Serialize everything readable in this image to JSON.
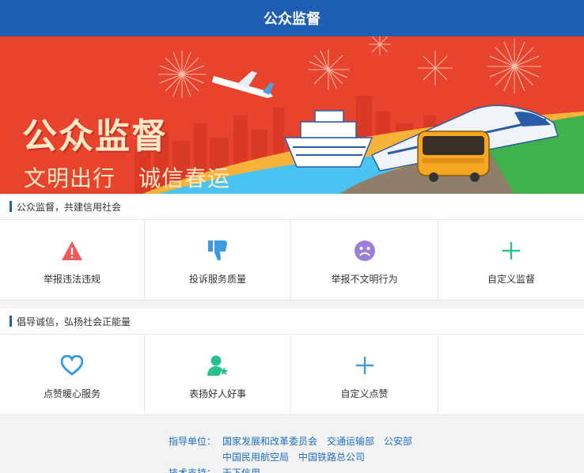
{
  "header": {
    "title": "公众监督"
  },
  "banner": {
    "title": "公众监督",
    "subtitle": "文明出行　诚信春运"
  },
  "section1": {
    "title": "公众监督，共建信用社会",
    "items": [
      {
        "label": "举报违法违规",
        "icon": "warning-icon",
        "color": "#f05a5a"
      },
      {
        "label": "投诉服务质量",
        "icon": "thumbs-down-icon",
        "color": "#3a9be0"
      },
      {
        "label": "举报不文明行为",
        "icon": "sad-face-icon",
        "color": "#9b7fd8"
      },
      {
        "label": "自定义监督",
        "icon": "plus-icon",
        "color": "#27c08a"
      }
    ]
  },
  "section2": {
    "title": "倡导诚信，弘扬社会正能量",
    "items": [
      {
        "label": "点赞暖心服务",
        "icon": "heart-icon",
        "color": "#3a9be0"
      },
      {
        "label": "表扬好人好事",
        "icon": "person-star-icon",
        "color": "#27c08a"
      },
      {
        "label": "自定义点赞",
        "icon": "plus-icon",
        "color": "#3a9be0"
      }
    ]
  },
  "footer": {
    "guide_label": "指导单位：",
    "guide_links_row1": [
      "国家发展和改革委员会",
      "交通运输部",
      "公安部"
    ],
    "guide_links_row2": [
      "中国民用航空局",
      "中国铁路总公司"
    ],
    "tech_label": "技术支持：",
    "tech_link": "天下信用"
  }
}
